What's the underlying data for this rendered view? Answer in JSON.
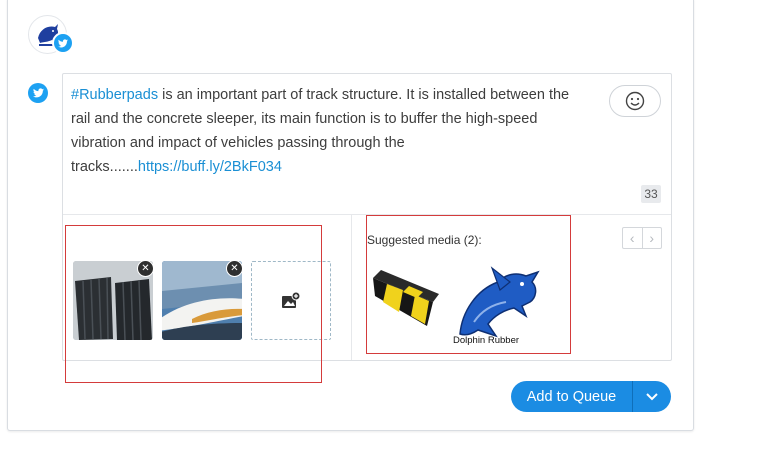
{
  "profile": {
    "avatar_icon": "dolphin-rubber-logo-icon",
    "network_badge_icon": "twitter-icon"
  },
  "post": {
    "hashtag": "#Rubberpads",
    "body": " is an important part of track structure. It is installed between the rail and the concrete sleeper, its main function is to buffer the high-speed vibration and impact of vehicles passing through the tracks.......",
    "link": "https://buff.ly/2BkF034",
    "char_count": "33"
  },
  "media": {
    "attached": [
      {
        "name": "rubber-pads-photo"
      },
      {
        "name": "high-speed-train-photo"
      }
    ],
    "add_media_icon": "add-image-icon"
  },
  "suggested": {
    "label": "Suggested media (2):",
    "items": [
      {
        "name": "speed-bump-image"
      },
      {
        "name": "dolphin-rubber-logo-image",
        "caption": "Dolphin Rubber"
      }
    ]
  },
  "actions": {
    "add_to_queue": "Add to Queue"
  },
  "colors": {
    "accent": "#1b8ce3",
    "link": "#1a8fd4",
    "highlight_box": "#d43b3b"
  }
}
